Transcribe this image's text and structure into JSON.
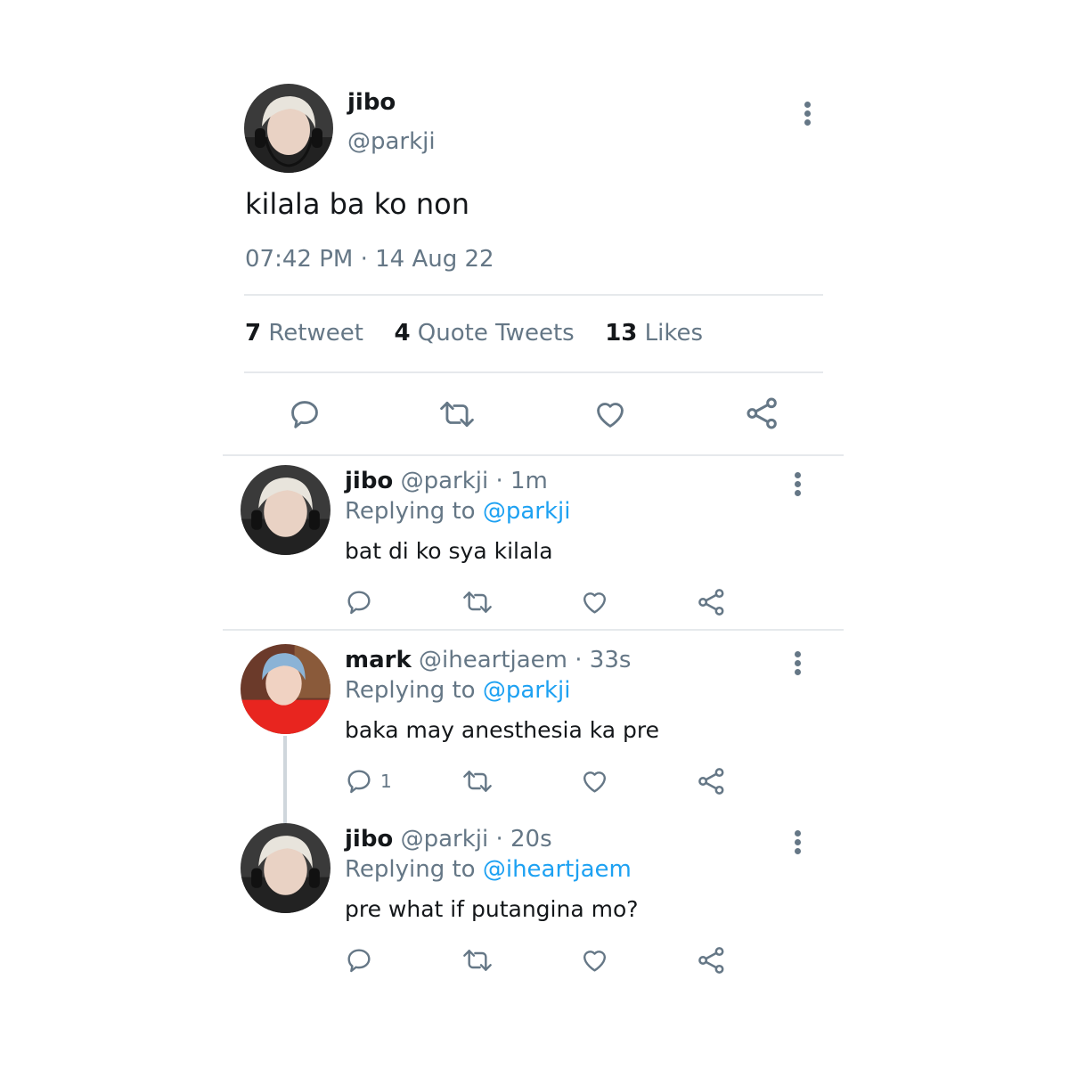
{
  "main_tweet": {
    "display_name": "jibo",
    "handle": "@parkji",
    "text": "kilala ba ko non",
    "timestamp": "07:42 PM · 14 Aug 22",
    "stats": {
      "retweet_count": "7",
      "retweet_label": "Retweet",
      "quote_count": "4",
      "quote_label": "Quote Tweets",
      "likes_count": "13",
      "likes_label": "Likes"
    }
  },
  "replies": [
    {
      "display_name": "jibo",
      "handle": "@parkji",
      "time": "· 1m",
      "replying_prefix": "Replying to",
      "replying_to": "@parkji",
      "text": "bat di ko sya kilala",
      "reply_count": ""
    },
    {
      "display_name": "mark",
      "handle": "@iheartjaem",
      "time": "· 33s",
      "replying_prefix": "Replying to",
      "replying_to": "@parkji",
      "text": "baka may anesthesia ka pre",
      "reply_count": "1"
    },
    {
      "display_name": "jibo",
      "handle": "@parkji",
      "time": "· 20s",
      "replying_prefix": "Replying to",
      "replying_to": "@iheartjaem",
      "text": "pre what if putangina mo?",
      "reply_count": ""
    }
  ],
  "colors": {
    "text": "#14171a",
    "muted": "#657786",
    "link": "#1da1f2",
    "divider": "#e6e9ec"
  },
  "icons": [
    "more-vertical-icon",
    "reply-icon",
    "retweet-icon",
    "like-icon",
    "share-icon"
  ]
}
